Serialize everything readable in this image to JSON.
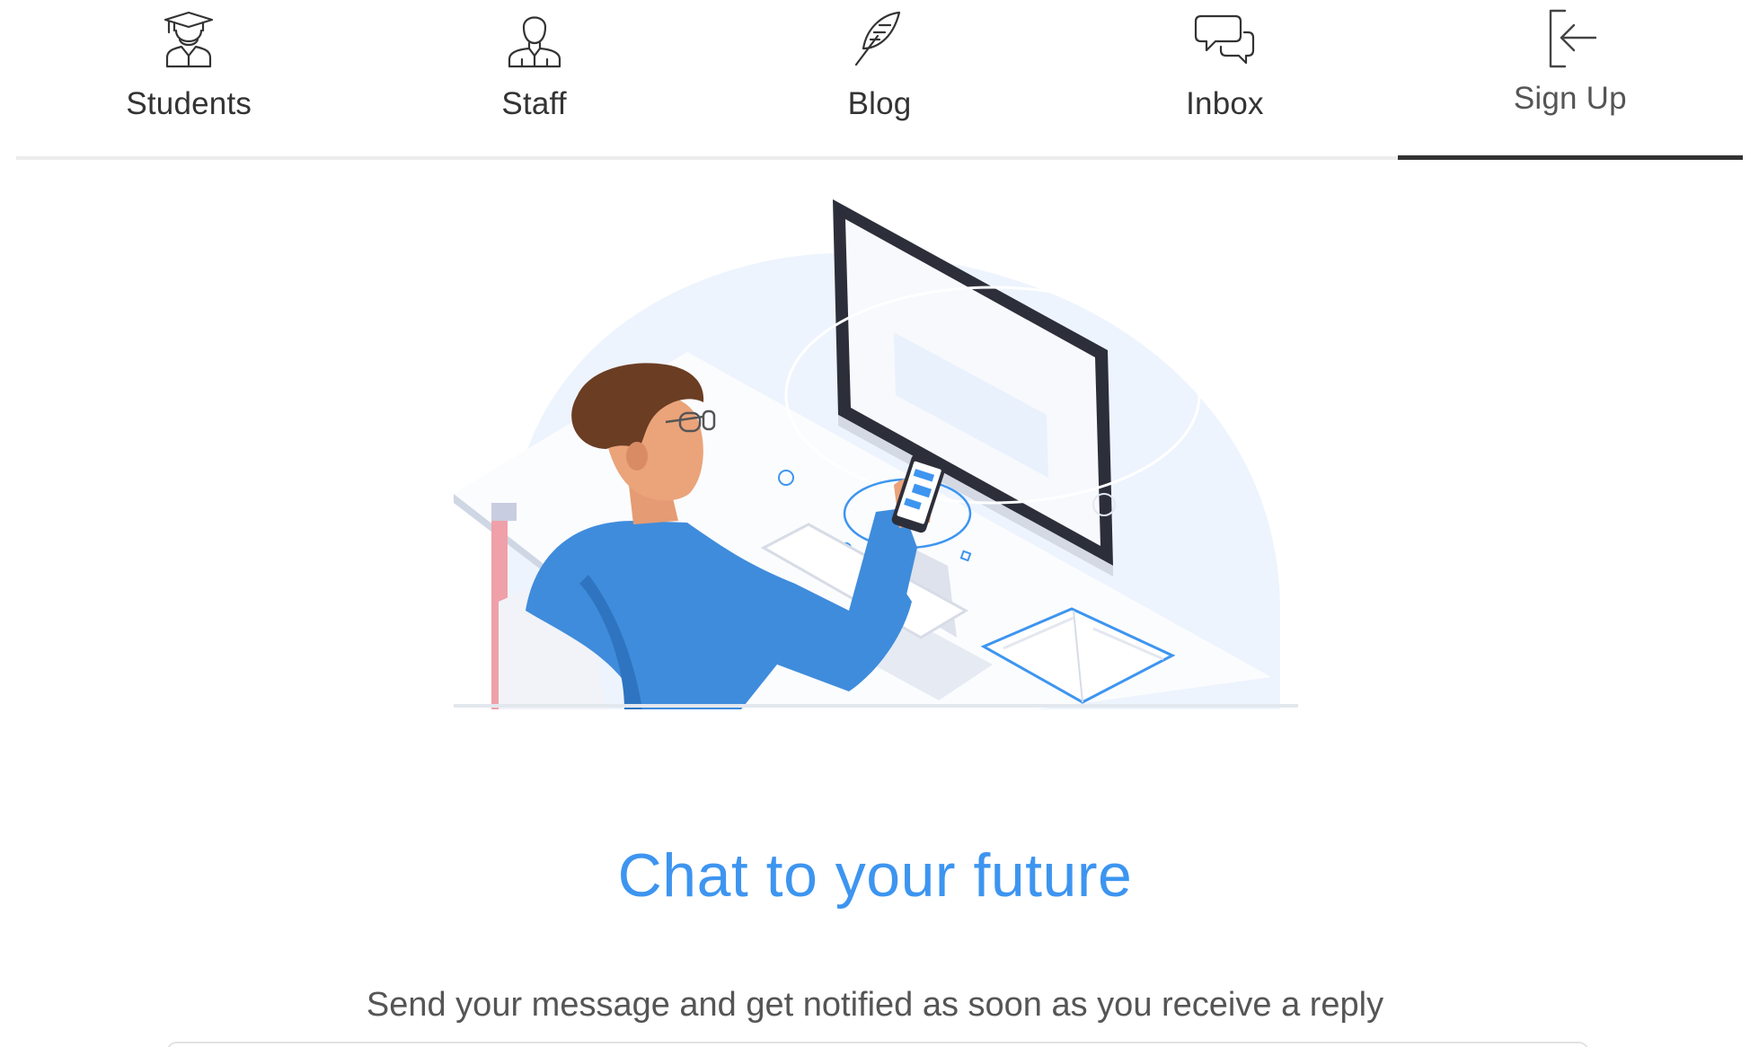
{
  "nav": {
    "items": [
      {
        "label": "Students",
        "icon": "graduate-icon"
      },
      {
        "label": "Staff",
        "icon": "staff-icon"
      },
      {
        "label": "Blog",
        "icon": "quill-icon"
      },
      {
        "label": "Inbox",
        "icon": "chat-bubbles-icon"
      },
      {
        "label": "Sign Up",
        "icon": "sign-in-arrow-icon",
        "active": true
      }
    ]
  },
  "hero": {
    "illustration": "person-at-desk-with-phone-and-monitor"
  },
  "main": {
    "headline": "Chat to your future",
    "subline": "Send your message and get notified as soon as you receive a reply"
  },
  "colors": {
    "accent": "#3d95f0",
    "text": "#333333",
    "muted": "#555555",
    "divider": "#ececec"
  }
}
